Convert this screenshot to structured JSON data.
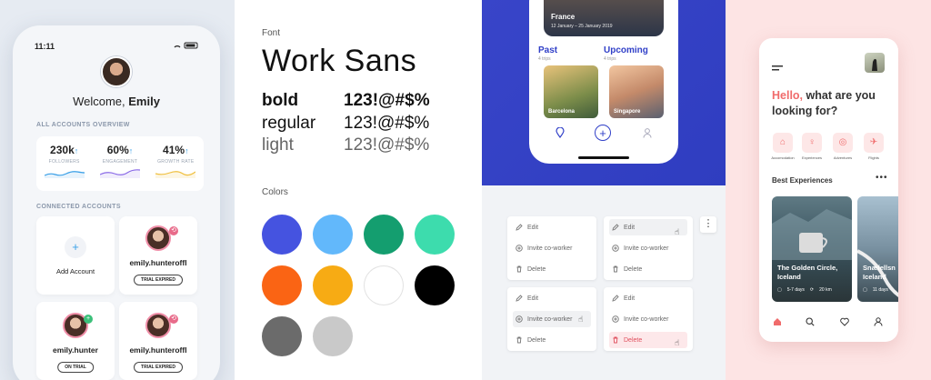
{
  "panel1": {
    "status_time": "11:11",
    "welcome_prefix": "Welcome, ",
    "welcome_name": "Emily",
    "overview_title": "ALL ACCOUNTS OVERVIEW",
    "stats": [
      {
        "value": "230k",
        "arrow": "↑",
        "label": "FOLLOWERS",
        "color": "#3aa0e8"
      },
      {
        "value": "60%",
        "arrow": "↑",
        "label": "ENGAGEMENT",
        "color": "#8b6be8"
      },
      {
        "value": "41%",
        "arrow": "↑",
        "label": "GROWTH RATE",
        "color": "#f0c040"
      }
    ],
    "connected_title": "CONNECTED ACCOUNTS",
    "add_account_label": "Add Account",
    "add_symbol": "+",
    "accounts": [
      {
        "name": "emily.hunteroffl",
        "badge": "TRIAL EXPIRED"
      },
      {
        "name": "emily.hunter",
        "badge": "ON TRIAL"
      },
      {
        "name": "emily.hunteroffl",
        "badge": "TRIAL EXPIRED"
      }
    ]
  },
  "panel2": {
    "font_label": "Font",
    "font_name": "Work Sans",
    "weights": [
      {
        "name": "bold",
        "sample": "123!@#$%"
      },
      {
        "name": "regular",
        "sample": "123!@#$%"
      },
      {
        "name": "light",
        "sample": "123!@#$%"
      }
    ],
    "colors_label": "Colors",
    "colors": [
      "#4553e0",
      "#62b8fb",
      "#149e6f",
      "#3ddcad",
      "#fa6414",
      "#f7ab14",
      "#ffffff",
      "#000000",
      "#6b6b6b",
      "#c9c9c9"
    ]
  },
  "panel3": {
    "hero_title": "France",
    "hero_dates": "12 January – 25 January 2019",
    "tabs": [
      {
        "label": "Past",
        "sub": "4 trips"
      },
      {
        "label": "Upcoming",
        "sub": "4 trips"
      }
    ],
    "trips": [
      "Barcelona",
      "Singapore"
    ],
    "menu_items": [
      "Edit",
      "Invite co-worker",
      "Delete"
    ],
    "kebab": "⋮"
  },
  "panel4": {
    "hello": "Hello,",
    "question_a": " what are you",
    "question_b": "looking for?",
    "categories": [
      {
        "label": "Accomodation",
        "icon": "home-icon",
        "glyph": "⌂"
      },
      {
        "label": "Experiences",
        "icon": "balloon-icon",
        "glyph": "♀"
      },
      {
        "label": "Adventures",
        "icon": "compass-icon",
        "glyph": "◎"
      },
      {
        "label": "Flights",
        "icon": "plane-icon",
        "glyph": "✈"
      }
    ],
    "best_title": "Best Experiences",
    "more": "•••",
    "experiences": [
      {
        "name_line1": "The Golden Circle,",
        "name_line2": "Iceland",
        "days": "5-7 days",
        "distance": "20 km"
      },
      {
        "name_line1": "Snæfellsn",
        "name_line2": "Iceland",
        "days": "11 days",
        "distance": ""
      }
    ]
  }
}
